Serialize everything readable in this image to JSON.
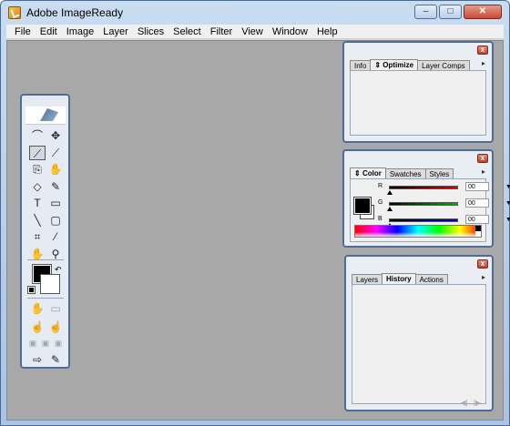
{
  "window": {
    "title": "Adobe ImageReady",
    "controls": {
      "minimize": "–",
      "maximize": "□",
      "close": "✕"
    }
  },
  "menu": [
    "File",
    "Edit",
    "Image",
    "Layer",
    "Slices",
    "Select",
    "Filter",
    "View",
    "Window",
    "Help"
  ],
  "toolbox": {
    "tools": [
      {
        "name": "lasso-tool-icon",
        "glyph": "⌒"
      },
      {
        "name": "move-tool-icon",
        "glyph": "✥"
      },
      {
        "name": "slice-tool-icon",
        "glyph": "⟋"
      },
      {
        "name": "slice-select-tool-icon",
        "glyph": "⟋"
      },
      {
        "name": "clone-stamp-tool-icon",
        "glyph": "⎘"
      },
      {
        "name": "history-brush-tool-icon",
        "glyph": "✋"
      },
      {
        "name": "eraser-tool-icon",
        "glyph": "◇"
      },
      {
        "name": "brush-tool-icon",
        "glyph": "✎"
      },
      {
        "name": "type-tool-icon",
        "glyph": "T"
      },
      {
        "name": "rectangle-tool-icon",
        "glyph": "▭"
      },
      {
        "name": "line-tool-icon",
        "glyph": "╲"
      },
      {
        "name": "rounded-rect-tool-icon",
        "glyph": "▢"
      },
      {
        "name": "crop-tool-icon",
        "glyph": "⌗"
      },
      {
        "name": "eyedropper-tool-icon",
        "glyph": "⁄"
      },
      {
        "name": "hand-tool-icon",
        "glyph": "✋"
      },
      {
        "name": "zoom-tool-icon",
        "glyph": "⚲"
      }
    ],
    "lower_tools": [
      {
        "name": "toggle-slices-icon",
        "glyph": "✋"
      },
      {
        "name": "image-map-icon",
        "glyph": "▭"
      },
      {
        "name": "rollover-preview-icon",
        "glyph": "☝"
      },
      {
        "name": "image-map-visibility-icon",
        "glyph": "☝"
      },
      {
        "name": "screen-mode-standard-icon",
        "glyph": "▣"
      },
      {
        "name": "screen-mode-full-menu-icon",
        "glyph": "▣"
      },
      {
        "name": "screen-mode-full-icon",
        "glyph": "▣"
      },
      {
        "name": "preview-in-browser-icon",
        "glyph": "⇨"
      },
      {
        "name": "jump-to-photoshop-icon",
        "glyph": "✎"
      }
    ]
  },
  "info_panel": {
    "tabs": [
      "Info",
      "Optimize",
      "Layer Comps"
    ],
    "active": "Optimize"
  },
  "color_panel": {
    "tabs": [
      "Color",
      "Swatches",
      "Styles"
    ],
    "active": "Color",
    "sliders": [
      {
        "label": "R",
        "value": "00",
        "color": "#e00000"
      },
      {
        "label": "G",
        "value": "00",
        "color": "#00b000"
      },
      {
        "label": "B",
        "value": "00",
        "color": "#0000c8"
      }
    ]
  },
  "history_panel": {
    "tabs": [
      "Layers",
      "History",
      "Actions"
    ],
    "active": "History",
    "footer": [
      "◀|",
      "|▶"
    ]
  },
  "colors": {
    "workspace": "#a8a8a8",
    "frame": "#4d6d97",
    "foreground": "#000000",
    "background": "#ffffff"
  }
}
